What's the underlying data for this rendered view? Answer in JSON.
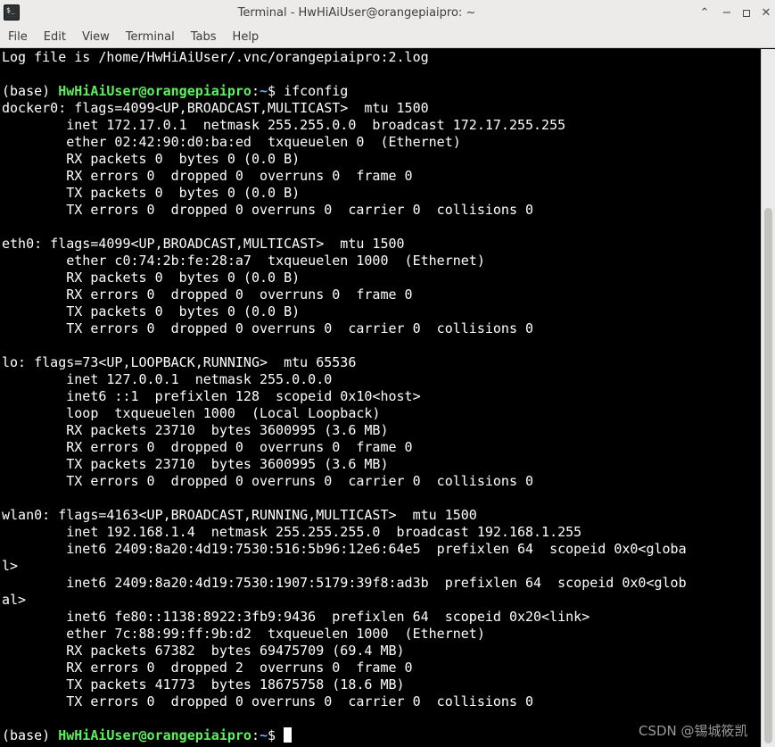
{
  "window": {
    "title": "Terminal - HwHiAiUser@orangepiaipro: ~",
    "controls": [
      "chevron-up-icon",
      "minimize-icon",
      "maximize-icon",
      "close-icon"
    ]
  },
  "menu": [
    "File",
    "Edit",
    "View",
    "Terminal",
    "Tabs",
    "Help"
  ],
  "prompt": {
    "env": "(base) ",
    "user_host": "HwHiAiUser@orangepiaipro",
    "sep": ":",
    "path": "~",
    "symbol": "$ "
  },
  "terminal_lines": [
    "Log file is /home/HwHiAiUser/.vnc/orangepiaipro:2.log",
    "",
    "__PROMPT__ifconfig",
    "docker0: flags=4099<UP,BROADCAST,MULTICAST>  mtu 1500",
    "        inet 172.17.0.1  netmask 255.255.0.0  broadcast 172.17.255.255",
    "        ether 02:42:90:d0:ba:ed  txqueuelen 0  (Ethernet)",
    "        RX packets 0  bytes 0 (0.0 B)",
    "        RX errors 0  dropped 0  overruns 0  frame 0",
    "        TX packets 0  bytes 0 (0.0 B)",
    "        TX errors 0  dropped 0 overruns 0  carrier 0  collisions 0",
    "",
    "eth0: flags=4099<UP,BROADCAST,MULTICAST>  mtu 1500",
    "        ether c0:74:2b:fe:28:a7  txqueuelen 1000  (Ethernet)",
    "        RX packets 0  bytes 0 (0.0 B)",
    "        RX errors 0  dropped 0  overruns 0  frame 0",
    "        TX packets 0  bytes 0 (0.0 B)",
    "        TX errors 0  dropped 0 overruns 0  carrier 0  collisions 0",
    "",
    "lo: flags=73<UP,LOOPBACK,RUNNING>  mtu 65536",
    "        inet 127.0.0.1  netmask 255.0.0.0",
    "        inet6 ::1  prefixlen 128  scopeid 0x10<host>",
    "        loop  txqueuelen 1000  (Local Loopback)",
    "        RX packets 23710  bytes 3600995 (3.6 MB)",
    "        RX errors 0  dropped 0  overruns 0  frame 0",
    "        TX packets 23710  bytes 3600995 (3.6 MB)",
    "        TX errors 0  dropped 0 overruns 0  carrier 0  collisions 0",
    "",
    "wlan0: flags=4163<UP,BROADCAST,RUNNING,MULTICAST>  mtu 1500",
    "        inet 192.168.1.4  netmask 255.255.255.0  broadcast 192.168.1.255",
    "        inet6 2409:8a20:4d19:7530:516:5b96:12e6:64e5  prefixlen 64  scopeid 0x0<globa",
    "l>",
    "        inet6 2409:8a20:4d19:7530:1907:5179:39f8:ad3b  prefixlen 64  scopeid 0x0<glob",
    "al>",
    "        inet6 fe80::1138:8922:3fb9:9436  prefixlen 64  scopeid 0x20<link>",
    "        ether 7c:88:99:ff:9b:d2  txqueuelen 1000  (Ethernet)",
    "        RX packets 67382  bytes 69475709 (69.4 MB)",
    "        RX errors 0  dropped 2  overruns 0  frame 0",
    "        TX packets 41773  bytes 18675758 (18.6 MB)",
    "        TX errors 0  dropped 0 overruns 0  carrier 0  collisions 0",
    "",
    "__PROMPT__"
  ],
  "watermark": "CSDN @锡城筱凯",
  "colors": {
    "prompt_user": "#5ff05f",
    "prompt_path": "#6ea8ff",
    "background": "#000000",
    "foreground": "#ffffff"
  }
}
